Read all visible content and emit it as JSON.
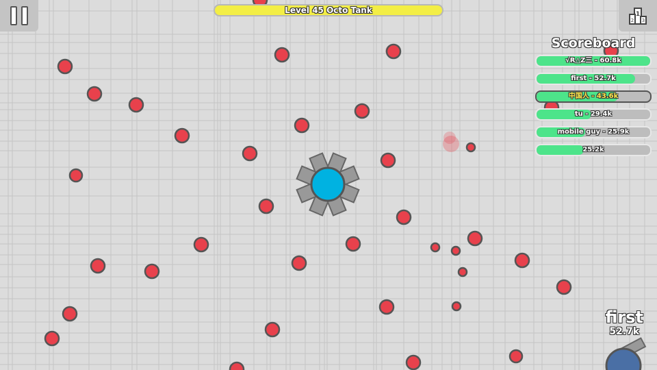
{
  "level_bar": {
    "text": "Level 45 Octo Tank",
    "color": "#f3ee45"
  },
  "buttons": {
    "pause_icon": "pause-icon",
    "ranking_icon": "podium-icon",
    "podium_digits": [
      "1",
      "2",
      "3"
    ]
  },
  "scoreboard": {
    "title": "Scoreboard",
    "entries": [
      {
        "label": "√R△Z三 - 60.8k",
        "score_k": 60.8
      },
      {
        "label": "first - 52.7k",
        "score_k": 52.7
      },
      {
        "label": "中国人 - 43.6k",
        "score_k": 43.6
      },
      {
        "label": "tu - 29.4k",
        "score_k": 29.4
      },
      {
        "label": "mobile guy - 25.9k",
        "score_k": 25.9
      },
      {
        "label": "25.2k",
        "score_k": 25.2
      }
    ]
  },
  "player": {
    "name": "first",
    "score": "52.7k"
  },
  "colors": {
    "background": "#cdcdcd",
    "grid": "#c3c3c3",
    "polygon_fill": "#e8414c",
    "polygon_stroke": "#555555",
    "tank_body": "#00b2e1",
    "tank_barrel": "#999999",
    "enemy_body": "#4a6fa5"
  }
}
